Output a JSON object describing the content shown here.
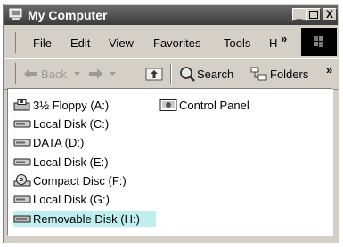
{
  "window": {
    "title": "My Computer"
  },
  "title_buttons": {
    "minimize": "_",
    "maximize": "□",
    "close": "X"
  },
  "menu": {
    "items": [
      "File",
      "Edit",
      "View",
      "Favorites",
      "Tools",
      "H"
    ],
    "overflow": "»"
  },
  "toolbar": {
    "back": "Back",
    "search": "Search",
    "folders": "Folders",
    "overflow": "»"
  },
  "drives": [
    {
      "label": "3½ Floppy (A:)",
      "icon": "floppy-icon"
    },
    {
      "label": "Local Disk (C:)",
      "icon": "hard-disk-icon"
    },
    {
      "label": "DATA (D:)",
      "icon": "hard-disk-icon"
    },
    {
      "label": "Local Disk (E:)",
      "icon": "hard-disk-icon"
    },
    {
      "label": "Compact Disc (F:)",
      "icon": "cd-drive-icon"
    },
    {
      "label": "Local Disk (G:)",
      "icon": "hard-disk-icon"
    },
    {
      "label": "Removable Disk (H:)",
      "icon": "removable-disk-icon",
      "selected": true
    }
  ],
  "other": [
    {
      "label": "Control Panel",
      "icon": "control-panel-icon"
    }
  ],
  "colors": {
    "selection": "#bfeeee",
    "titlebar": "#4a4a4a"
  }
}
